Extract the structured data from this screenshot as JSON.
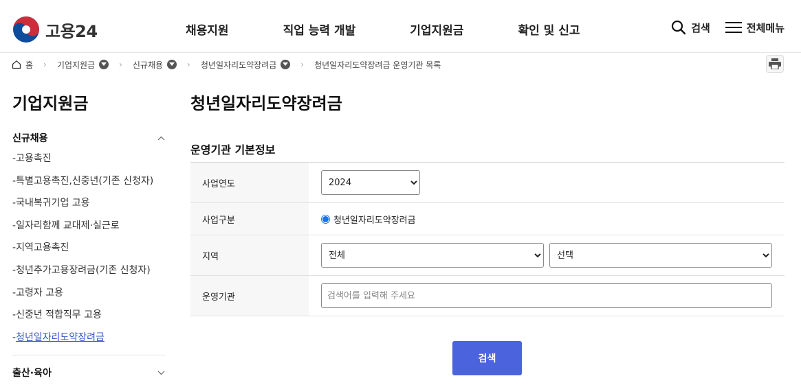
{
  "header": {
    "logo_text": "고용24",
    "nav": [
      "채용지원",
      "직업 능력 개발",
      "기업지원금",
      "확인 및 신고"
    ],
    "search_label": "검색",
    "menu_label": "전체메뉴"
  },
  "breadcrumb": {
    "home": "홈",
    "items": [
      "기업지원금",
      "신규채용",
      "청년일자리도약장려금"
    ],
    "current": "청년일자리도약장려금 운영기관 목록"
  },
  "sidebar": {
    "title": "기업지원금",
    "group1": "신규채용",
    "items": [
      "고용촉진",
      "특별고용촉진,신중년(기존 신청자)",
      "국내복귀기업 고용",
      "일자리함께 교대제·실근로",
      "지역고용촉진",
      "청년추가고용장려금(기존 신청자)",
      "고령자 고용",
      "신중년 적합직무 고용",
      "청년일자리도약장려금"
    ],
    "active_index": 8,
    "group2": "출산·육아"
  },
  "main": {
    "title": "청년일자리도약장려금",
    "section": "운영기관 기본정보",
    "rows": {
      "year_label": "사업연도",
      "year_value": "2024",
      "type_label": "사업구분",
      "type_value": "청년일자리도약장려금",
      "region_label": "지역",
      "region_value": "전체",
      "region_sub_value": "선택",
      "org_label": "운영기관",
      "org_placeholder": "검색어를 입력해 주세요"
    },
    "search_button": "검색"
  },
  "colors": {
    "accent": "#4b63dc",
    "active_link": "#3754c7",
    "logo_red": "#cd2e3a",
    "logo_blue": "#0f4c9b"
  }
}
